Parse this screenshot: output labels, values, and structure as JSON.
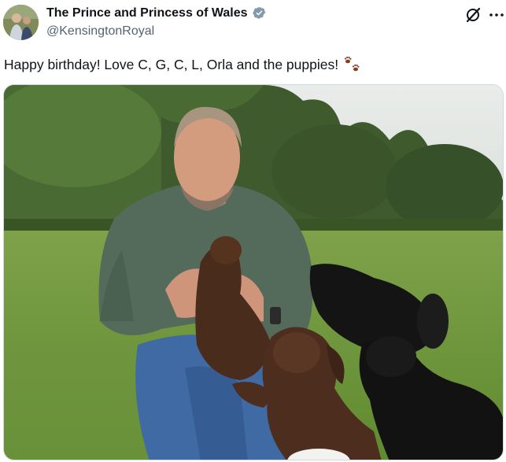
{
  "tweet": {
    "author": {
      "display_name": "The Prince and Princess of Wales",
      "handle": "@KensingtonRoyal",
      "verified": true,
      "verified_badge_color": "#829aab"
    },
    "text": "Happy birthday! Love C, G, C, L, Orla and the puppies!",
    "emoji": "paw-prints-icon",
    "media": {
      "type": "photo"
    }
  },
  "icons": {
    "verified": "verified-badge-icon",
    "grok": "grok-icon",
    "more": "more-icon"
  },
  "colors": {
    "text_primary": "#0f1419",
    "text_secondary": "#536471",
    "paw_color": "#8b3a1e"
  }
}
